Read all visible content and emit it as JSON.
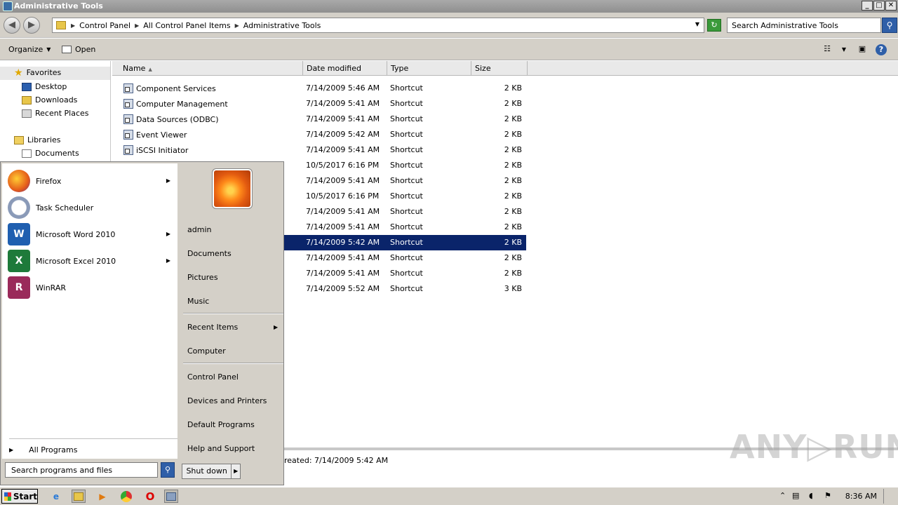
{
  "window": {
    "title": "Administrative Tools",
    "controls": [
      "_",
      "□",
      "✕"
    ]
  },
  "address": {
    "crumbs": [
      "Control Panel",
      "All Control Panel Items",
      "Administrative Tools"
    ],
    "search_placeholder": "Search Administrative Tools"
  },
  "toolbar": {
    "organize": "Organize",
    "open": "Open"
  },
  "nav": {
    "favorites": "Favorites",
    "desktop": "Desktop",
    "downloads": "Downloads",
    "recent_places": "Recent Places",
    "libraries": "Libraries",
    "documents": "Documents"
  },
  "columns": {
    "name": "Name",
    "date": "Date modified",
    "type": "Type",
    "size": "Size"
  },
  "files": [
    {
      "name": "Component Services",
      "date": "7/14/2009 5:46 AM",
      "type": "Shortcut",
      "size": "2 KB"
    },
    {
      "name": "Computer Management",
      "date": "7/14/2009 5:41 AM",
      "type": "Shortcut",
      "size": "2 KB"
    },
    {
      "name": "Data Sources (ODBC)",
      "date": "7/14/2009 5:41 AM",
      "type": "Shortcut",
      "size": "2 KB"
    },
    {
      "name": "Event Viewer",
      "date": "7/14/2009 5:42 AM",
      "type": "Shortcut",
      "size": "2 KB"
    },
    {
      "name": "iSCSI Initiator",
      "date": "7/14/2009 5:41 AM",
      "type": "Shortcut",
      "size": "2 KB"
    },
    {
      "name": "",
      "date": "10/5/2017 6:16 PM",
      "type": "Shortcut",
      "size": "2 KB"
    },
    {
      "name": "",
      "date": "7/14/2009 5:41 AM",
      "type": "Shortcut",
      "size": "2 KB"
    },
    {
      "name": "",
      "date": "10/5/2017 6:16 PM",
      "type": "Shortcut",
      "size": "2 KB"
    },
    {
      "name": "",
      "date": "7/14/2009 5:41 AM",
      "type": "Shortcut",
      "size": "2 KB"
    },
    {
      "name": "",
      "date": "7/14/2009 5:41 AM",
      "type": "Shortcut",
      "size": "2 KB"
    },
    {
      "name": "",
      "date": "7/14/2009 5:42 AM",
      "type": "Shortcut",
      "size": "2 KB"
    },
    {
      "name": "",
      "date": "7/14/2009 5:41 AM",
      "type": "Shortcut",
      "size": "2 KB"
    },
    {
      "name": "",
      "date": "7/14/2009 5:41 AM",
      "type": "Shortcut",
      "size": "2 KB"
    },
    {
      "name": "",
      "date": "7/14/2009 5:52 AM",
      "type": "Shortcut",
      "size": "3 KB"
    }
  ],
  "details": {
    "created": "reated: 7/14/2009 5:42 AM"
  },
  "watermark": "ANY▷RUN",
  "start_menu": {
    "programs": [
      "Firefox",
      "Task Scheduler",
      "Microsoft Word 2010",
      "Microsoft Excel 2010",
      "WinRAR"
    ],
    "program_glyphs": [
      "",
      "",
      "W",
      "X",
      "R"
    ],
    "all_programs": "All Programs",
    "search_placeholder": "Search programs and files",
    "places": [
      "admin",
      "Documents",
      "Pictures",
      "Music",
      "Recent Items",
      "Computer",
      "Control Panel",
      "Devices and Printers",
      "Default Programs",
      "Help and Support"
    ],
    "shutdown": "Shut down"
  },
  "taskbar": {
    "start": "Start",
    "time": "8:36 AM"
  }
}
